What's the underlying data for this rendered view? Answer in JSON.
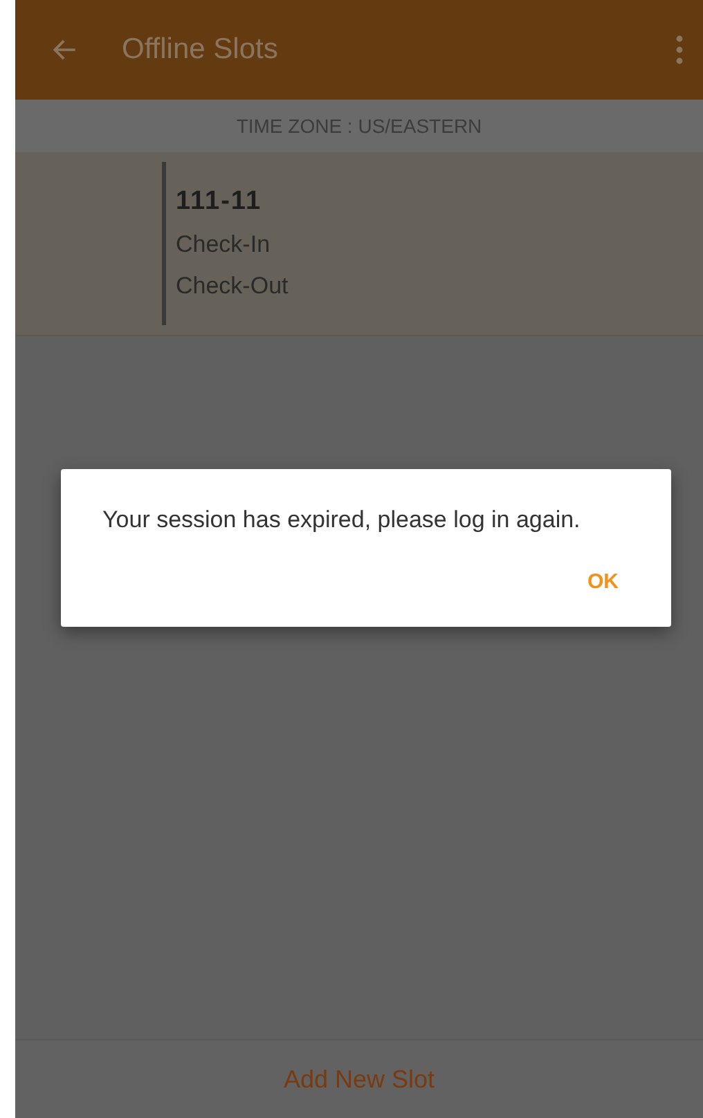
{
  "app_bar": {
    "title": "Offline Slots"
  },
  "time_zone": "TIME ZONE : US/EASTERN",
  "slots": [
    {
      "code": "111-11",
      "lines": [
        "Check-In",
        "Check-Out"
      ]
    }
  ],
  "dialog": {
    "message": "Your session has expired, please log in again.",
    "buttons": [
      "OK"
    ]
  },
  "footer": {
    "button": "Add New Slot"
  }
}
